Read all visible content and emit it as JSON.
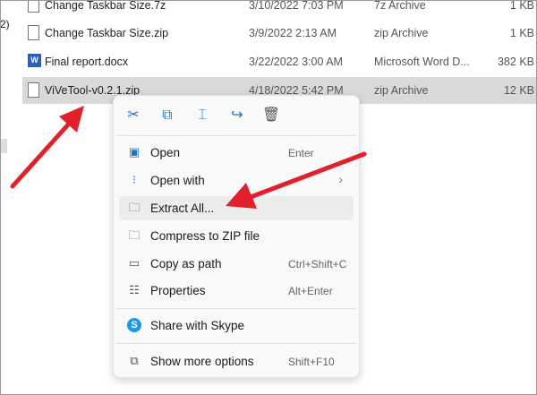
{
  "sidebar": {
    "fragment": "2)"
  },
  "files": [
    {
      "name": "Change Taskbar Size.7z",
      "date": "3/10/2022 7:03 PM",
      "type": "7z Archive",
      "size": "1 KB",
      "icon": "file-icon"
    },
    {
      "name": "Change Taskbar Size.zip",
      "date": "3/9/2022 2:13 AM",
      "type": "zip Archive",
      "size": "1 KB",
      "icon": "file-icon"
    },
    {
      "name": "Final report.docx",
      "date": "3/22/2022 3:00 AM",
      "type": "Microsoft Word D...",
      "size": "382 KB",
      "icon": "word-icon"
    },
    {
      "name": "ViVeTool-v0.2.1.zip",
      "date": "4/18/2022 5:42 PM",
      "type": "zip Archive",
      "size": "12 KB",
      "icon": "file-icon"
    }
  ],
  "word_glyph": "W",
  "menu": {
    "toolbar": [
      "cut-icon",
      "copy-icon",
      "rename-icon",
      "share-icon",
      "delete-icon"
    ],
    "items": [
      {
        "label": "Open",
        "shortcut": "Enter"
      },
      {
        "label": "Open with",
        "chevron": "›"
      },
      {
        "label": "Extract All..."
      },
      {
        "label": "Compress to ZIP file"
      },
      {
        "label": "Copy as path",
        "shortcut": "Ctrl+Shift+C"
      },
      {
        "label": "Properties",
        "shortcut": "Alt+Enter"
      },
      {
        "label": "Share with Skype"
      },
      {
        "label": "Show more options",
        "shortcut": "Shift+F10"
      }
    ]
  },
  "annotation_color": "#e0202a"
}
